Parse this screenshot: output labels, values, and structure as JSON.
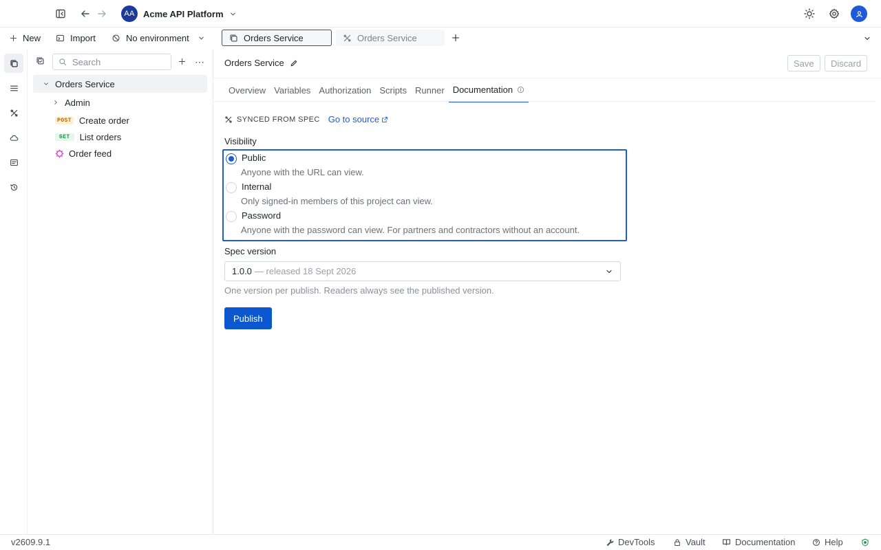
{
  "topbar": {
    "workspace_initials": "AA",
    "workspace_name": "Acme API Platform",
    "colors": {
      "workspace_avatar": "#1d3a9a",
      "user_avatar": "#1f5bd8"
    }
  },
  "toolbar": {
    "new_label": "New",
    "import_label": "Import",
    "environment_label": "No environment"
  },
  "tabs": [
    {
      "label": "Orders Service",
      "active": true
    },
    {
      "label": "Orders Service",
      "active": false
    }
  ],
  "sidebar": {
    "search_placeholder": "Search",
    "tree": {
      "root": "Orders Service",
      "folder": "Admin",
      "requests": [
        {
          "method": "POST",
          "name": "Create order"
        },
        {
          "method": "GET",
          "name": "List orders"
        }
      ],
      "feed": "Order feed"
    }
  },
  "main": {
    "title": "Orders Service",
    "save_label": "Save",
    "discard_label": "Discard",
    "subtabs": [
      "Overview",
      "Variables",
      "Authorization",
      "Scripts",
      "Runner",
      "Documentation"
    ],
    "active_subtab": "Documentation",
    "synced_label": "SYNCED FROM SPEC",
    "go_to_source": "Go to source",
    "visibility_label": "Visibility",
    "options": [
      {
        "title": "Public",
        "desc": "Anyone with the URL can view.",
        "selected": true
      },
      {
        "title": "Internal",
        "desc": "Only signed-in members of this project can view.",
        "selected": false
      },
      {
        "title": "Password",
        "desc": "Anyone with the password can view. For partners and contractors without an account.",
        "selected": false
      }
    ],
    "spec_version_label": "Spec version",
    "spec_version_value": "1.0.0",
    "spec_version_release": "— released 18 Sept 2026",
    "spec_hint": "One version per publish. Readers always see the published version.",
    "publish_label": "Publish",
    "accent_color": "#0b57d0"
  },
  "statusbar": {
    "version": "v2609.9.1",
    "devtools": "DevTools",
    "vault": "Vault",
    "documentation": "Documentation",
    "help": "Help"
  }
}
